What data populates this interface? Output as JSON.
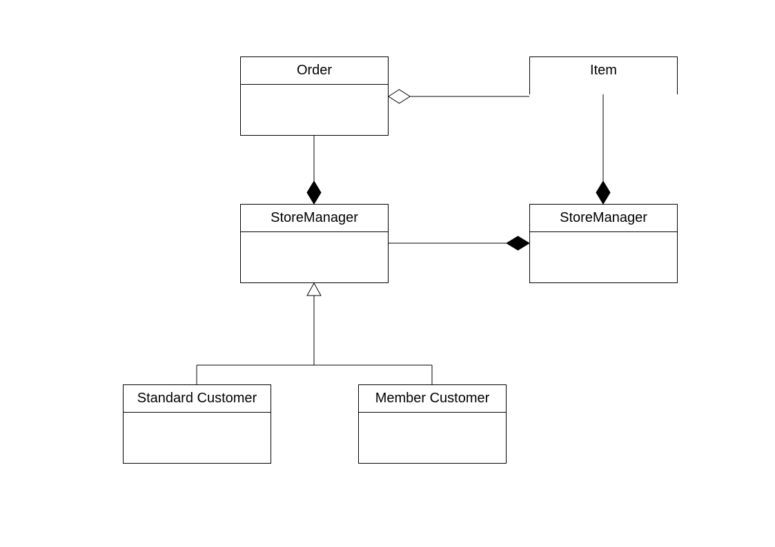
{
  "classes": {
    "order": {
      "name": "Order"
    },
    "item": {
      "name": "Item"
    },
    "storeManagerLeft": {
      "name": "StoreManager"
    },
    "storeManagerRight": {
      "name": "StoreManager"
    },
    "standardCustomer": {
      "name": "Standard Customer"
    },
    "memberCustomer": {
      "name": "Member Customer"
    }
  }
}
